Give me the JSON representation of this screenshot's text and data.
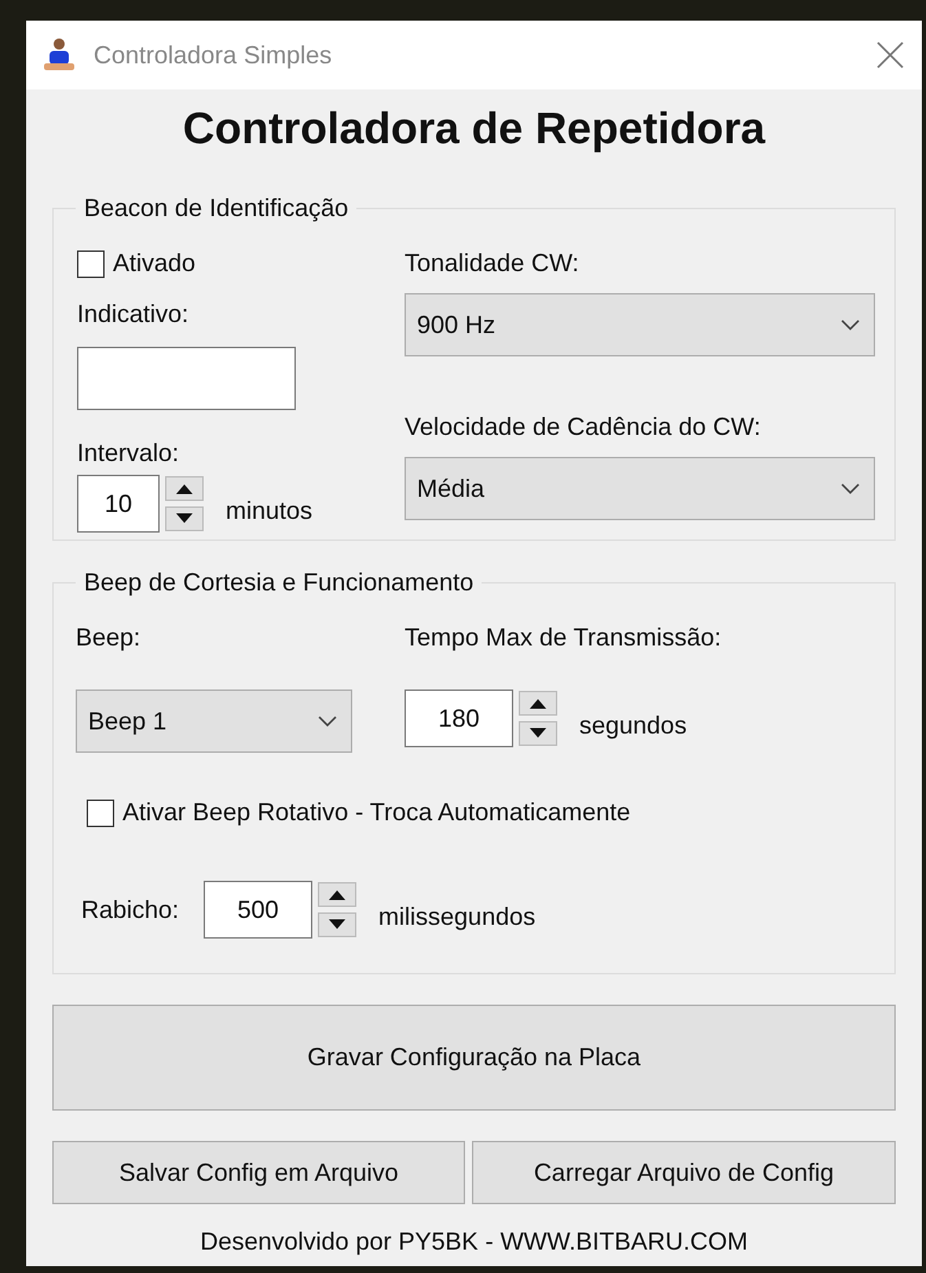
{
  "window": {
    "title": "Controladora Simples"
  },
  "heading": "Controladora de Repetidora",
  "beacon_group": {
    "legend": "Beacon de Identificação",
    "enabled": {
      "label": "Ativado",
      "checked": false
    },
    "callsign": {
      "label": "Indicativo:"
    },
    "interval": {
      "label": "Intervalo:",
      "value": "10",
      "unit": "minutos"
    },
    "tone": {
      "label": "Tonalidade CW:",
      "value": "900 Hz"
    },
    "speed": {
      "label": "Velocidade de Cadência do CW:",
      "value": "Média"
    }
  },
  "beep_group": {
    "legend": "Beep de Cortesia e Funcionamento",
    "beep": {
      "label": "Beep:",
      "value": "Beep 1"
    },
    "max_tx": {
      "label": "Tempo Max de Transmissão:",
      "value": "180",
      "unit": "segundos"
    },
    "rotating": {
      "label": "Ativar Beep Rotativo - Troca Automaticamente",
      "checked": false
    },
    "tail": {
      "label": "Rabicho:",
      "value": "500",
      "unit": "milissegundos"
    }
  },
  "buttons": [
    "Gravar Configuração na Placa",
    "Salvar Config em Arquivo",
    "Carregar Arquivo de Config"
  ],
  "footer": "Desenvolvido por PY5BK - WWW.BITBARU.COM"
}
